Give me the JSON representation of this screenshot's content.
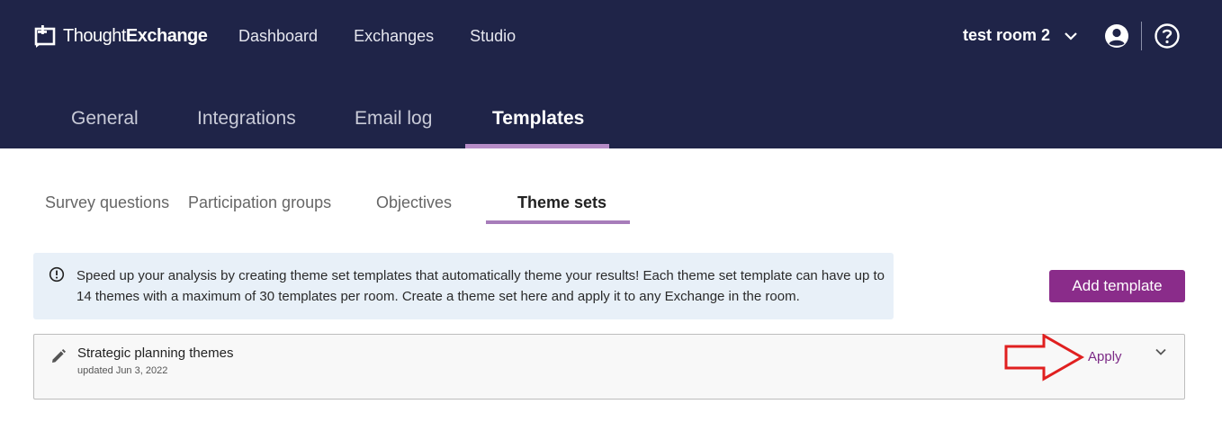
{
  "brand": {
    "name_light": "Thought",
    "name_bold": "Exchange"
  },
  "topnav": {
    "items": [
      "Dashboard",
      "Exchanges",
      "Studio"
    ]
  },
  "room": {
    "label": "test room 2"
  },
  "icons": {
    "room_dropdown": "chevron-down-icon",
    "user": "user-circle-icon",
    "help": "help-circle-icon",
    "info": "info-circle-icon",
    "edit": "pencil-icon",
    "expand": "chevron-down-icon"
  },
  "main_tabs": {
    "items": [
      "General",
      "Integrations",
      "Email log",
      "Templates"
    ],
    "active": "Templates"
  },
  "sub_tabs": {
    "items": [
      "Survey questions",
      "Participation groups",
      "Objectives",
      "Theme sets"
    ],
    "active": "Theme sets"
  },
  "info_banner": {
    "text": "Speed up your analysis by creating theme set templates that automatically theme your results! Each theme set template can have up to 14 themes with a maximum of 30 templates per room. Create a theme set here and apply it to any Exchange in the room."
  },
  "actions": {
    "add_template": "Add template"
  },
  "templates": [
    {
      "title": "Strategic planning themes",
      "updated": "updated Jun 3, 2022",
      "action": "Apply"
    }
  ],
  "colors": {
    "header_bg": "#1f2448",
    "accent_purple": "#8a2c8a",
    "tab_underline": "#b68cc7",
    "info_bg": "#e8f0f8",
    "annotation_red": "#e02020"
  }
}
